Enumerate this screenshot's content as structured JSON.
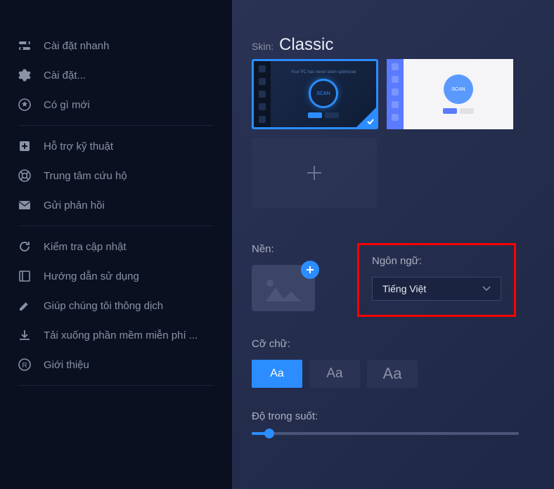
{
  "sidebar": {
    "group1": [
      {
        "icon": "toggles-icon",
        "label": "Cài đặt nhanh"
      },
      {
        "icon": "gear-icon",
        "label": "Cài đặt..."
      },
      {
        "icon": "star-icon",
        "label": "Có gì mới"
      }
    ],
    "group2": [
      {
        "icon": "plus-square-icon",
        "label": "Hỗ trợ kỹ thuật"
      },
      {
        "icon": "lifebuoy-icon",
        "label": "Trung tâm cứu hộ"
      },
      {
        "icon": "envelope-icon",
        "label": "Gửi phản hồi"
      }
    ],
    "group3": [
      {
        "icon": "refresh-icon",
        "label": "Kiểm tra cập nhật"
      },
      {
        "icon": "book-icon",
        "label": "Hướng dẫn sử dụng"
      },
      {
        "icon": "pencil-icon",
        "label": "Giúp chúng tôi thông dịch"
      },
      {
        "icon": "download-icon",
        "label": "Tải xuống phần mềm miễn phí ..."
      },
      {
        "icon": "registered-icon",
        "label": "Giới thiệu"
      }
    ]
  },
  "main": {
    "skin_label": "Skin:",
    "skin_value": "Classic",
    "scan_text": "SCAN",
    "background_label": "Nền:",
    "language_label": "Ngôn ngữ:",
    "language_value": "Tiếng Việt",
    "font_label": "Cỡ chữ:",
    "font_sizes": [
      "Aa",
      "Aa",
      "Aa"
    ],
    "font_selected": 0,
    "opacity_label": "Độ trong suốt:"
  }
}
